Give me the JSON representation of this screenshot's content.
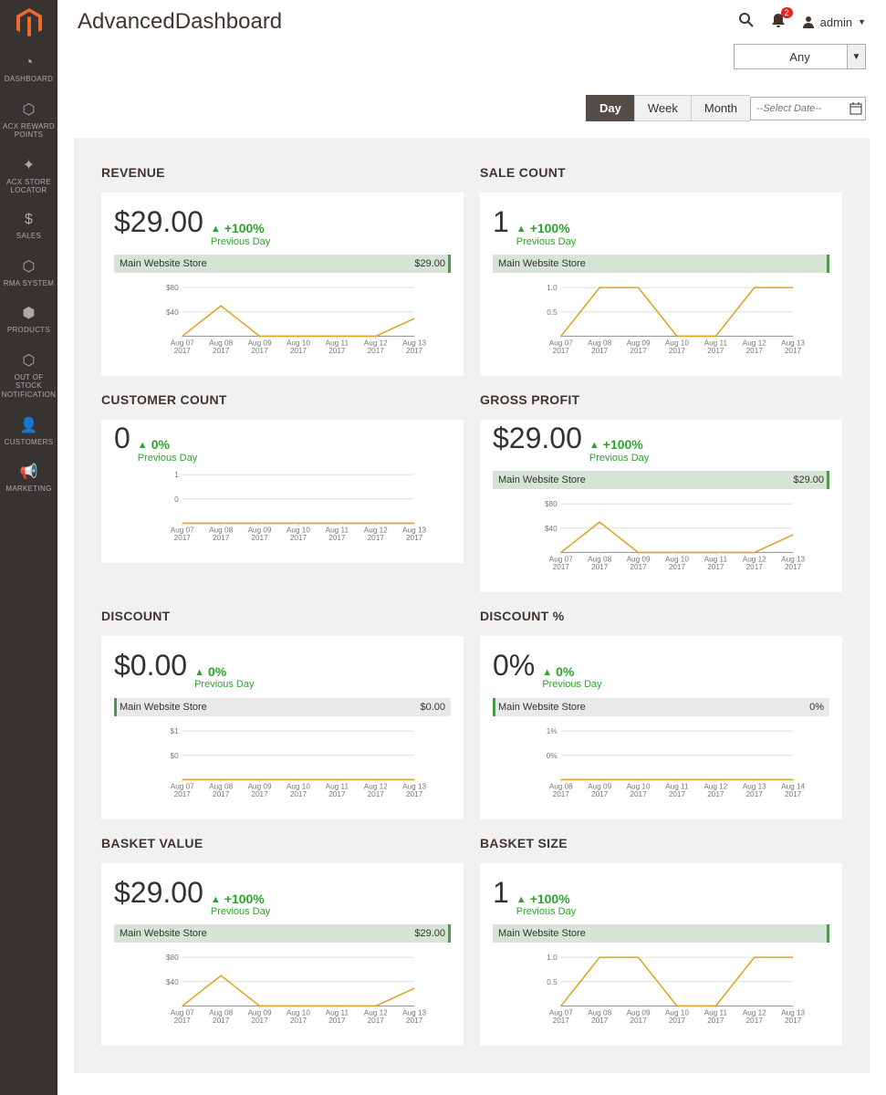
{
  "header": {
    "title": "AdvancedDashboard",
    "notif_count": "2",
    "user": "admin"
  },
  "storeSelect": {
    "value": "Any"
  },
  "timeTabs": {
    "day": "Day",
    "week": "Week",
    "month": "Month",
    "active": "Day"
  },
  "datePicker": {
    "placeholder": "--Select Date--"
  },
  "nav": [
    {
      "label": "DASHBOARD"
    },
    {
      "label": "ACX REWARD POINTS"
    },
    {
      "label": "ACX STORE LOCATOR"
    },
    {
      "label": "SALES"
    },
    {
      "label": "RMA SYSTEM"
    },
    {
      "label": "PRODUCTS"
    },
    {
      "label": "OUT OF STOCK NOTIFICATION"
    },
    {
      "label": "CUSTOMERS"
    },
    {
      "label": "MARKETING"
    }
  ],
  "widgets": {
    "revenue": {
      "title": "REVENUE",
      "value": "$29.00",
      "trend": "+100%",
      "sub": "Previous Day",
      "storeLabel": "Main Website Store",
      "storeVal": "$29.00"
    },
    "saleCount": {
      "title": "SALE COUNT",
      "value": "1",
      "trend": "+100%",
      "sub": "Previous Day",
      "storeLabel": "Main Website Store",
      "storeVal": ""
    },
    "customerCount": {
      "title": "CUSTOMER COUNT",
      "value": "0",
      "trend": "0%",
      "sub": "Previous Day",
      "storeLabel": "",
      "storeVal": ""
    },
    "grossProfit": {
      "title": "GROSS PROFIT",
      "value": "$29.00",
      "trend": "+100%",
      "sub": "Previous Day",
      "storeLabel": "Main Website Store",
      "storeVal": "$29.00"
    },
    "discount": {
      "title": "DISCOUNT",
      "value": "$0.00",
      "trend": "0%",
      "sub": "Previous Day",
      "storeLabel": "Main Website Store",
      "storeVal": "$0.00"
    },
    "discountPct": {
      "title": "DISCOUNT %",
      "value": "0%",
      "trend": "0%",
      "sub": "Previous Day",
      "storeLabel": "Main Website Store",
      "storeVal": "0%"
    },
    "basketValue": {
      "title": "BASKET VALUE",
      "value": "$29.00",
      "trend": "+100%",
      "sub": "Previous Day",
      "storeLabel": "Main Website Store",
      "storeVal": "$29.00"
    },
    "basketSize": {
      "title": "BASKET SIZE",
      "value": "1",
      "trend": "+100%",
      "sub": "Previous Day",
      "storeLabel": "Main Website Store",
      "storeVal": ""
    }
  },
  "chart_data": [
    {
      "id": "revenue",
      "type": "line",
      "x": [
        "Aug 07, 2017",
        "Aug 08, 2017",
        "Aug 09, 2017",
        "Aug 10, 2017",
        "Aug 11, 2017",
        "Aug 12, 2017",
        "Aug 13, 2017"
      ],
      "yTicks": [
        "$40",
        "$80"
      ],
      "values": [
        0,
        50,
        0,
        0,
        0,
        0,
        29
      ]
    },
    {
      "id": "saleCount",
      "type": "line",
      "x": [
        "Aug 07, 2017",
        "Aug 08, 2017",
        "Aug 09, 2017",
        "Aug 10, 2017",
        "Aug 11, 2017",
        "Aug 12, 2017",
        "Aug 13, 2017"
      ],
      "yTicks": [
        "0.5",
        "1.0"
      ],
      "values": [
        0,
        1,
        1,
        0,
        0,
        1,
        1
      ]
    },
    {
      "id": "customerCount",
      "type": "line",
      "x": [
        "Aug 07, 2017",
        "Aug 08, 2017",
        "Aug 09, 2017",
        "Aug 10, 2017",
        "Aug 11, 2017",
        "Aug 12, 2017",
        "Aug 13, 2017"
      ],
      "yTicks": [
        "0",
        "1"
      ],
      "values": [
        0,
        0,
        0,
        0,
        0,
        0,
        0
      ]
    },
    {
      "id": "grossProfit",
      "type": "line",
      "x": [
        "Aug 07, 2017",
        "Aug 08, 2017",
        "Aug 09, 2017",
        "Aug 10, 2017",
        "Aug 11, 2017",
        "Aug 12, 2017",
        "Aug 13, 2017"
      ],
      "yTicks": [
        "$40",
        "$80"
      ],
      "values": [
        0,
        50,
        0,
        0,
        0,
        0,
        29
      ]
    },
    {
      "id": "discount",
      "type": "line",
      "x": [
        "Aug 07, 2017",
        "Aug 08, 2017",
        "Aug 09, 2017",
        "Aug 10, 2017",
        "Aug 11, 2017",
        "Aug 12, 2017",
        "Aug 13, 2017"
      ],
      "yTicks": [
        "$0",
        "$1"
      ],
      "values": [
        0,
        0,
        0,
        0,
        0,
        0,
        0
      ]
    },
    {
      "id": "discountPct",
      "type": "line",
      "x": [
        "Aug 08, 2017",
        "Aug 09, 2017",
        "Aug 10, 2017",
        "Aug 11, 2017",
        "Aug 12, 2017",
        "Aug 13, 2017",
        "Aug 14, 2017"
      ],
      "yTicks": [
        "0%",
        "1%"
      ],
      "values": [
        0,
        0,
        0,
        0,
        0,
        0,
        0
      ]
    },
    {
      "id": "basketValue",
      "type": "line",
      "x": [
        "Aug 07, 2017",
        "Aug 08, 2017",
        "Aug 09, 2017",
        "Aug 10, 2017",
        "Aug 11, 2017",
        "Aug 12, 2017",
        "Aug 13, 2017"
      ],
      "yTicks": [
        "$40",
        "$80"
      ],
      "values": [
        0,
        50,
        0,
        0,
        0,
        0,
        29
      ]
    },
    {
      "id": "basketSize",
      "type": "line",
      "x": [
        "Aug 07, 2017",
        "Aug 08, 2017",
        "Aug 09, 2017",
        "Aug 10, 2017",
        "Aug 11, 2017",
        "Aug 12, 2017",
        "Aug 13, 2017"
      ],
      "yTicks": [
        "0.5",
        "1.0"
      ],
      "values": [
        0,
        1,
        1,
        0,
        0,
        1,
        1
      ]
    }
  ]
}
